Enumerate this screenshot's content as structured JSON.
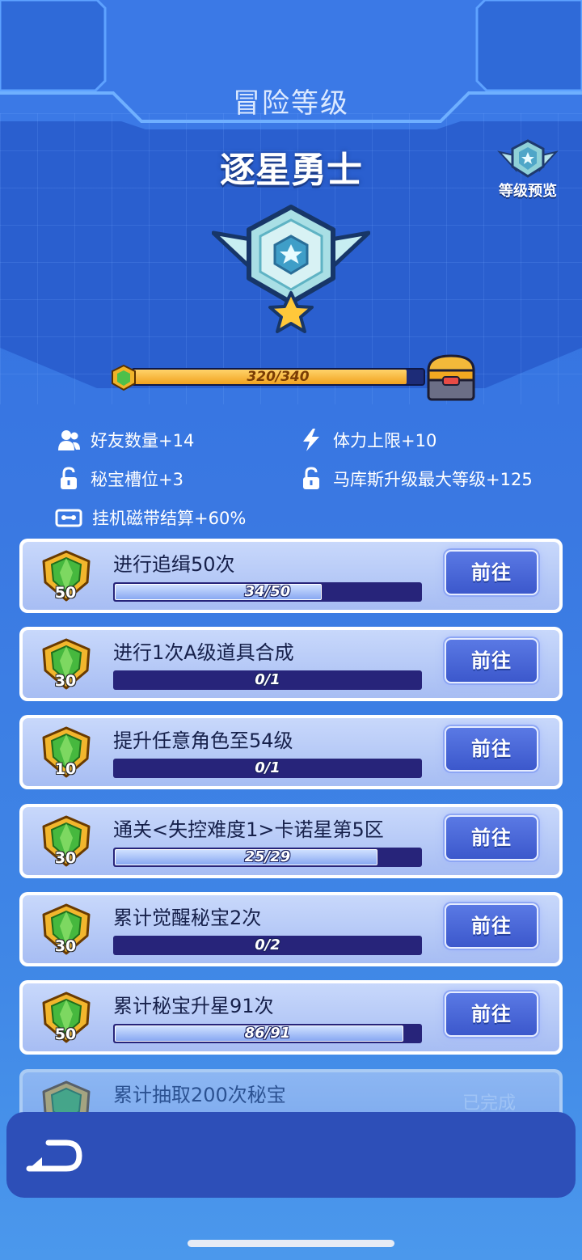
{
  "header": {
    "title": "冒险等级"
  },
  "rank": {
    "name": "逐星勇士",
    "preview_label": "等级预览",
    "exp_text": "320/340",
    "exp_fraction": 0.941
  },
  "perks": [
    {
      "icon": "friends-icon",
      "label": "好友数量+14"
    },
    {
      "icon": "stamina-icon",
      "label": "体力上限+10"
    },
    {
      "icon": "unlock-icon",
      "label": "秘宝槽位+3"
    },
    {
      "icon": "unlock-icon",
      "label": "马库斯升级最大等级+125"
    },
    {
      "icon": "tape-icon",
      "label": "挂机磁带结算+60%"
    }
  ],
  "tasks": [
    {
      "reward": "50",
      "title": "进行追缉50次",
      "progress_text": "34/50",
      "progress": 0.68,
      "button": "前往"
    },
    {
      "reward": "30",
      "title": "进行1次A级道具合成",
      "progress_text": "0/1",
      "progress": 0,
      "button": "前往"
    },
    {
      "reward": "10",
      "title": "提升任意角色至54级",
      "progress_text": "0/1",
      "progress": 0,
      "button": "前往"
    },
    {
      "reward": "30",
      "title": "通关<失控难度1>卡诺星第5区",
      "progress_text": "25/29",
      "progress": 0.862,
      "button": "前往"
    },
    {
      "reward": "30",
      "title": "累计觉醒秘宝2次",
      "progress_text": "0/2",
      "progress": 0,
      "button": "前往"
    },
    {
      "reward": "50",
      "title": "累计秘宝升星91次",
      "progress_text": "86/91",
      "progress": 0.945,
      "button": "前往"
    },
    {
      "title": "累计抽取200次秘宝",
      "status": "已完成"
    }
  ],
  "colors": {
    "accent_button": "#4a68d8",
    "progress_fill": "#9db8f5",
    "exp_fill": "#f5b63a"
  }
}
